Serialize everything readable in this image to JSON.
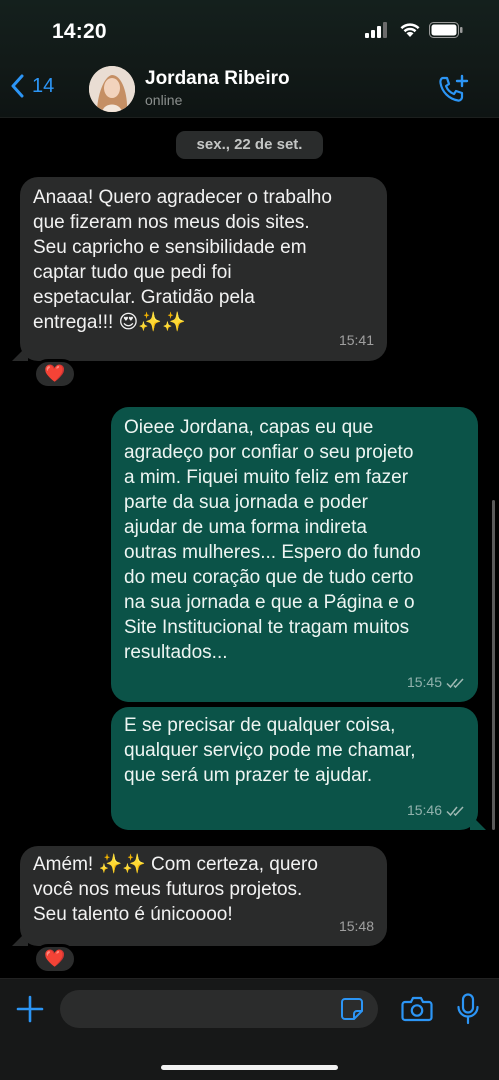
{
  "status_bar": {
    "time": "14:20",
    "icons": [
      "signal-icon",
      "wifi-icon",
      "battery-icon"
    ]
  },
  "header": {
    "back_count": "14",
    "contact_name": "Jordana Ribeiro",
    "contact_status": "online",
    "icons": [
      "chevron-left-icon",
      "add-call-icon"
    ]
  },
  "date_chip": "sex., 22 de set.",
  "messages": [
    {
      "direction": "incoming",
      "text": "Anaaa! Quero agradecer o trabalho\nque fizeram nos meus dois sites.\nSeu capricho e sensibilidade em\ncaptar tudo que pedi foi\nespetacular. Gratidão pela\nentrega!!! 😍✨✨",
      "time": "15:41",
      "reaction": "❤️"
    },
    {
      "direction": "outgoing",
      "text": "Oieee Jordana, capas eu que\nagradeço por confiar o seu projeto\na mim. Fiquei muito feliz em fazer\nparte da sua jornada e poder\najudar de uma forma indireta\noutras mulheres... Espero do fundo\ndo meu coração que de tudo certo\nna sua jornada e que a Página e o\nSite Institucional te tragam muitos\nresultados...",
      "time": "15:45",
      "status": "read"
    },
    {
      "direction": "outgoing",
      "text": "E se precisar de qualquer coisa,\nqualquer serviço pode me chamar,\nque será um prazer te ajudar.",
      "time": "15:46",
      "status": "read"
    },
    {
      "direction": "incoming",
      "text": "Amém! ✨✨ Com certeza, quero\nvocê nos meus futuros projetos.\nSeu talento é únicoooo!",
      "time": "15:48",
      "reaction": "❤️"
    }
  ],
  "composer": {
    "input_value": "",
    "icons": [
      "plus-icon",
      "sticker-icon",
      "camera-icon",
      "microphone-icon"
    ]
  },
  "colors": {
    "accent": "#2c95f5",
    "incoming_bubble": "#2a2b2b",
    "outgoing_bubble": "#0b5348",
    "background": "#000000"
  }
}
